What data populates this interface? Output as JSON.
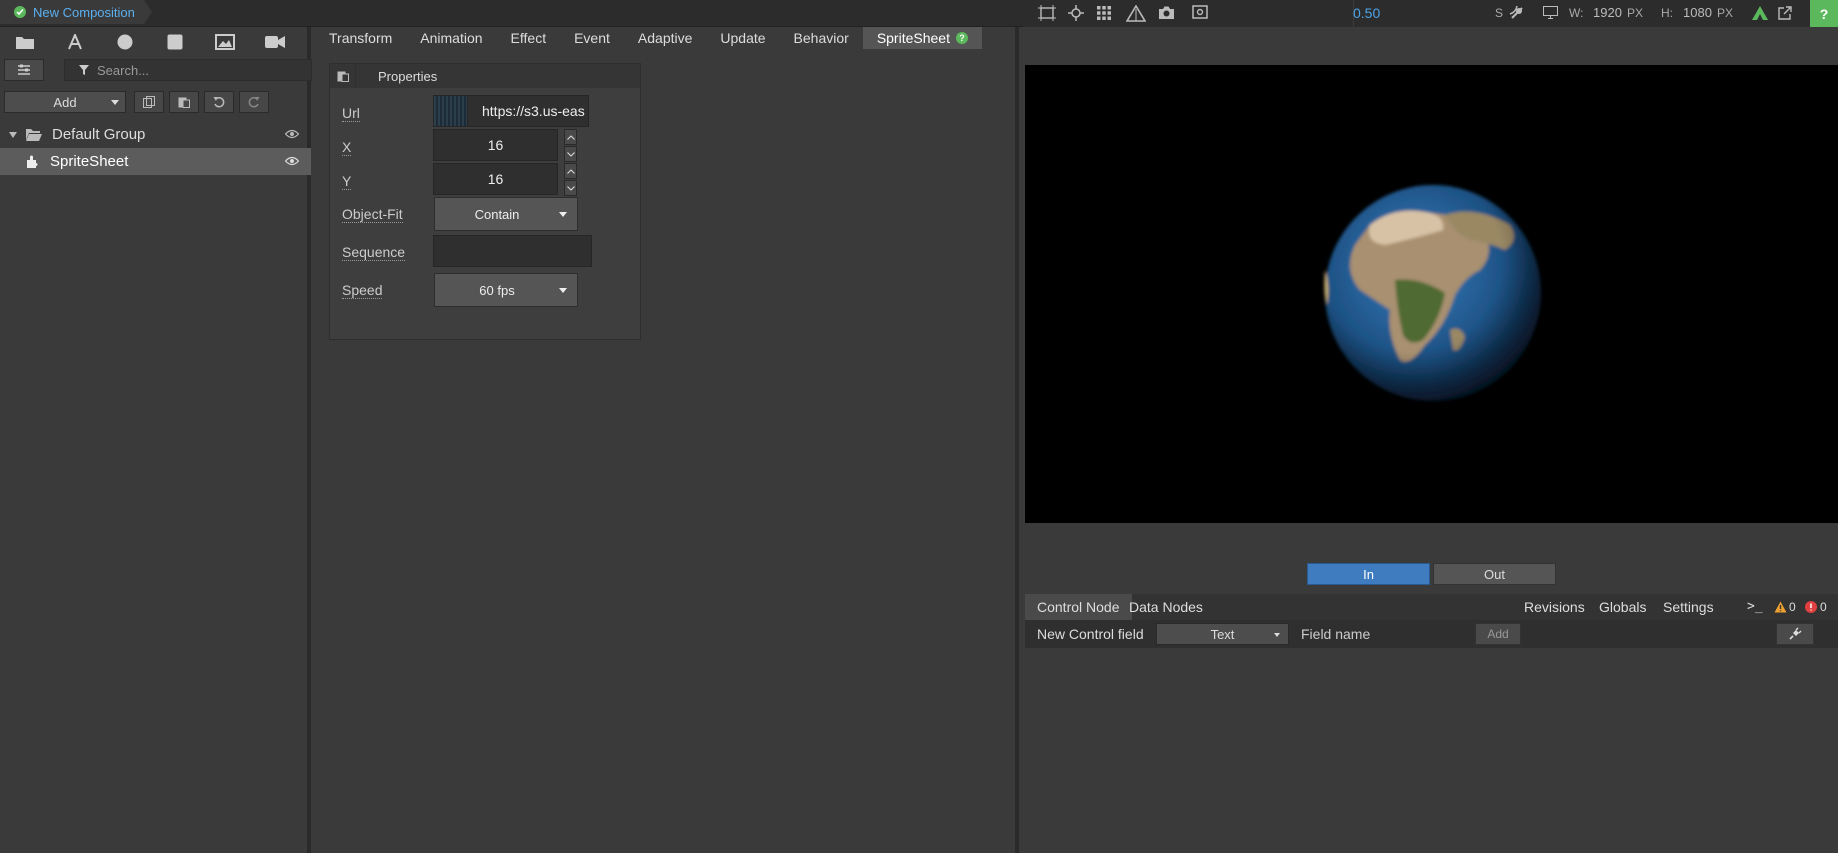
{
  "composition": {
    "title": "New Composition"
  },
  "left": {
    "search_placeholder": "Search...",
    "add_label": "Add",
    "tree": [
      {
        "label": "Default Group"
      },
      {
        "label": "SpriteSheet"
      }
    ]
  },
  "tabs": [
    "Transform",
    "Animation",
    "Effect",
    "Event",
    "Adaptive",
    "Update",
    "Behavior",
    "SpriteSheet"
  ],
  "properties": {
    "header": "Properties",
    "url_label": "Url",
    "url_value": "https://s3.us-eas",
    "x_label": "X",
    "x_value": "16",
    "y_label": "Y",
    "y_value": "16",
    "fit_label": "Object-Fit",
    "fit_value": "Contain",
    "sequence_label": "Sequence",
    "sequence_value": "",
    "speed_label": "Speed",
    "speed_value": "60 fps"
  },
  "viewport": {
    "zoom": "0.50",
    "s_label": "S",
    "w_label": "W:",
    "w_value": "1920",
    "w_unit": "PX",
    "h_label": "H:",
    "h_value": "1080",
    "h_unit": "PX",
    "in_label": "In",
    "out_label": "Out"
  },
  "bottom": {
    "tab_control": "Control Node",
    "tab_data": "Data Nodes",
    "tab_revisions": "Revisions",
    "tab_globals": "Globals",
    "tab_settings": "Settings",
    "warnings": "0",
    "errors": "0",
    "new_field_label": "New Control field",
    "field_type": "Text",
    "field_name_placeholder": "Field name",
    "add_label": "Add"
  },
  "colors": {
    "accent": "#4da3e8",
    "ok": "#5cb85c",
    "warning": "#f0a030",
    "error": "#e04040"
  }
}
